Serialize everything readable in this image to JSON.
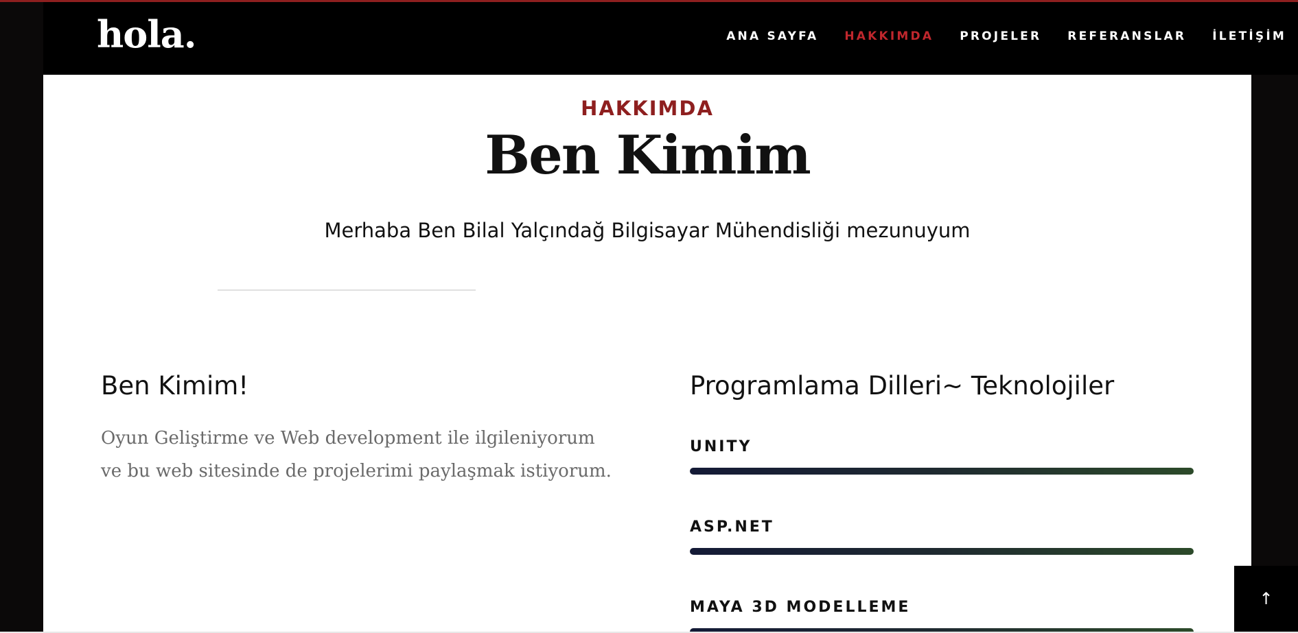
{
  "brand": {
    "logo": "hola."
  },
  "nav": {
    "items": [
      {
        "label": "ANA SAYFA",
        "active": false
      },
      {
        "label": "HAKKIMDA",
        "active": true
      },
      {
        "label": "PROJELER",
        "active": false
      },
      {
        "label": "REFERANSLAR",
        "active": false
      },
      {
        "label": "İLETİŞİM",
        "active": false
      }
    ]
  },
  "about": {
    "kicker": "HAKKIMDA",
    "title": "Ben Kimim",
    "subtitle": "Merhaba Ben Bilal Yalçındağ Bilgisayar Mühendisliği mezunuyum",
    "left_heading": "Ben Kimim!",
    "left_text_line1": "Oyun Geliştirme ve Web development ile ilgileniyorum",
    "left_text_line2": "ve bu web sitesinde de projelerimi paylaşmak istiyorum.",
    "right_heading": "Programlama Dilleri~ Teknolojiler",
    "skills": [
      {
        "label": "UNITY",
        "level": 1.0
      },
      {
        "label": "ASP.NET",
        "level": 1.0
      },
      {
        "label": "MAYA 3D MODELLEME",
        "level": 1.0
      }
    ]
  },
  "back_to_top": {
    "icon": "arrow-up-icon",
    "glyph": "↑"
  },
  "colors": {
    "accent": "#c0272d",
    "kicker": "#8e1f1f",
    "bar_start": "#141a36",
    "bar_end": "#2c4a2a"
  }
}
